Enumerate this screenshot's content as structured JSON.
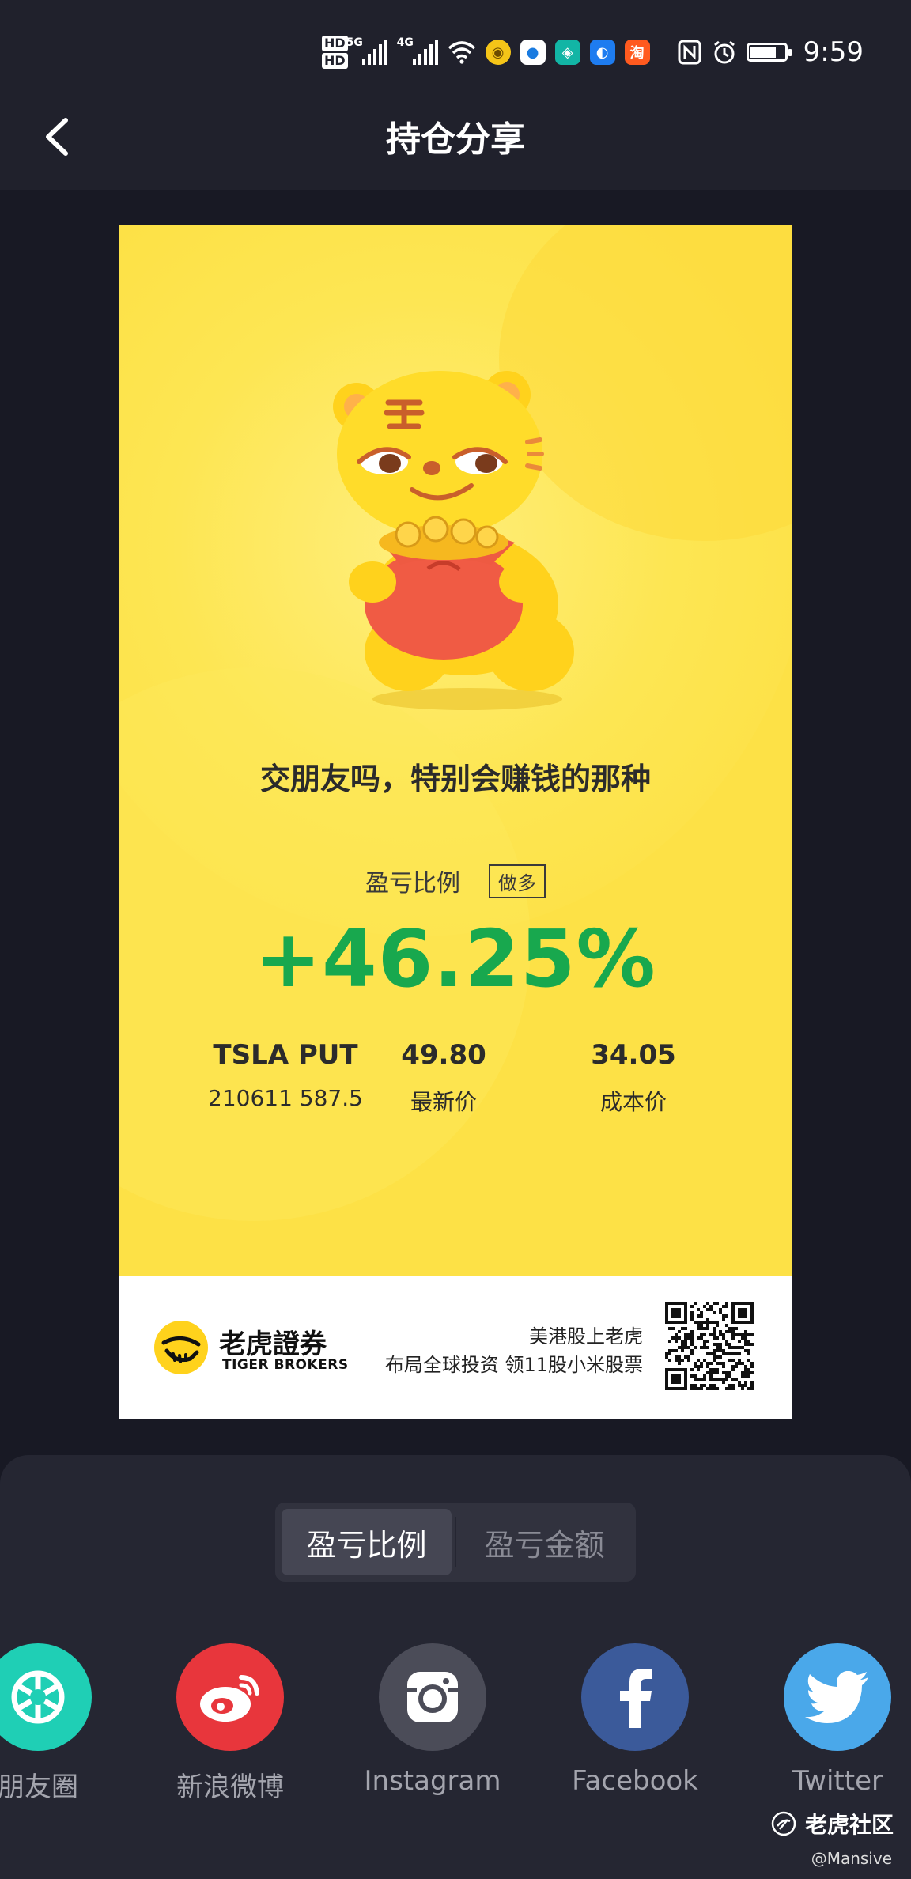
{
  "status_bar": {
    "hd1": "HD",
    "hd2": "HD",
    "net1": "5G",
    "net2": "4G",
    "time": "9:59",
    "app_icons": [
      "coin-icon",
      "drop-icon",
      "app-icon",
      "chat-icon",
      "taobao-icon"
    ],
    "taobao_label": "淘"
  },
  "header": {
    "title": "持仓分享"
  },
  "card": {
    "slogan": "交朋友吗，特别会赚钱的那种",
    "ratio_label": "盈亏比例",
    "side_badge": "做多",
    "pnl_percent": "+46.25%",
    "pnl_color": "#18a84e",
    "stats": [
      {
        "value": "TSLA PUT",
        "label": "210611 587.5"
      },
      {
        "value": "49.80",
        "label": "最新价"
      },
      {
        "value": "34.05",
        "label": "成本价"
      }
    ],
    "footer": {
      "brand_cn": "老虎證券",
      "brand_en": "TIGER BROKERS",
      "promo_line1": "美港股上老虎",
      "promo_line2": "布局全球投资 领11股小米股票"
    }
  },
  "sheet": {
    "tabs": [
      {
        "label": "盈亏比例",
        "active": true
      },
      {
        "label": "盈亏金额",
        "active": false
      }
    ],
    "share_targets": [
      {
        "label": "朋友圈",
        "icon": "moments-icon",
        "color": "#1fcfb5"
      },
      {
        "label": "新浪微博",
        "icon": "weibo-icon",
        "color": "#e8363c"
      },
      {
        "label": "Instagram",
        "icon": "instagram-icon",
        "color": "#4b4c58"
      },
      {
        "label": "Facebook",
        "icon": "facebook-icon",
        "color": "#3b5a9a"
      },
      {
        "label": "Twitter",
        "icon": "twitter-icon",
        "color": "#4aa8ea"
      }
    ]
  },
  "watermark": {
    "site": "老虎社区",
    "user": "@Mansive"
  }
}
